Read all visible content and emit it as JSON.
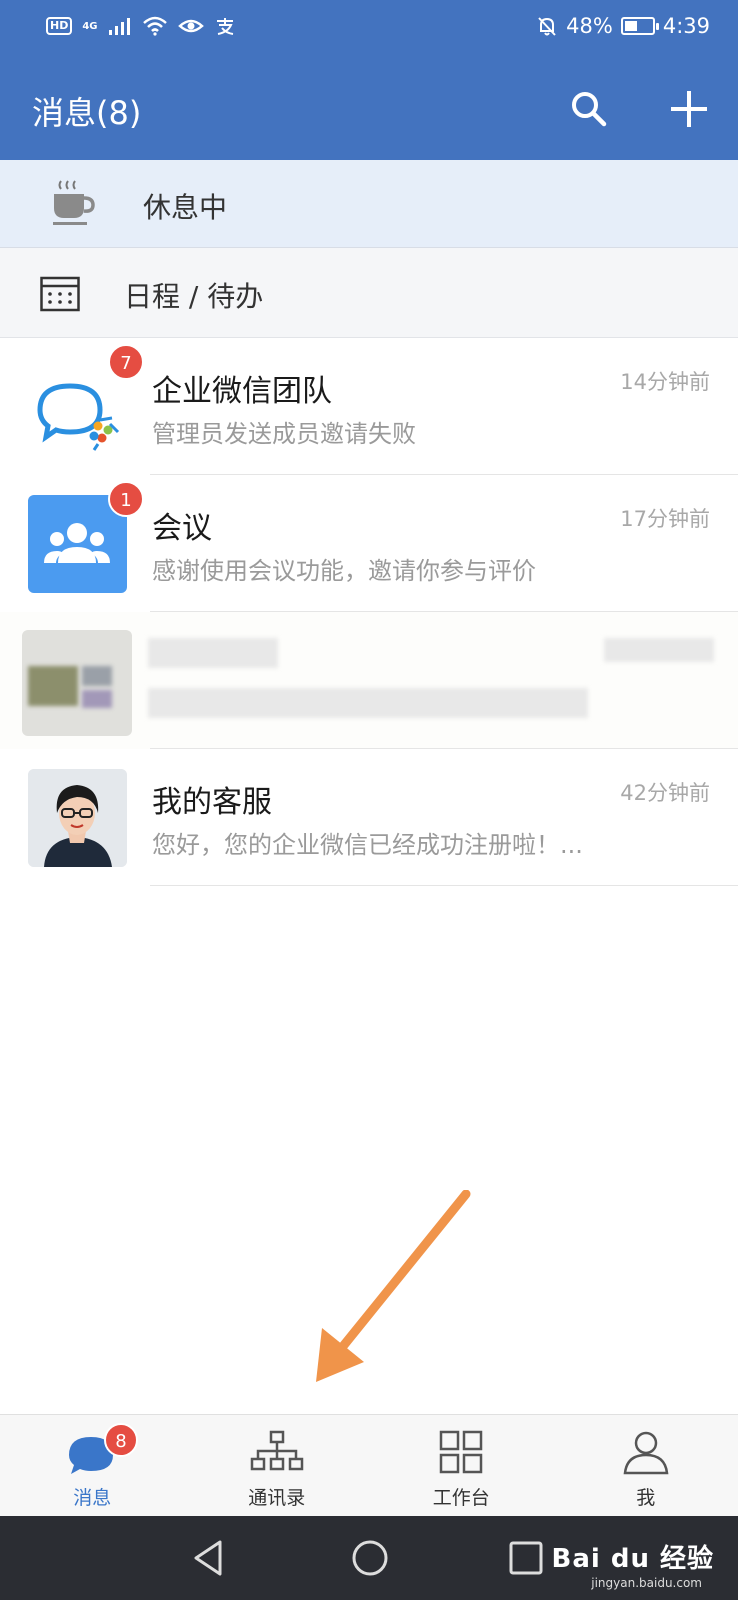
{
  "status_bar": {
    "hd": "HD",
    "network": "4G",
    "battery": "48%",
    "time": "4:39",
    "battery_level": 0.48
  },
  "header": {
    "title": "消息(8)",
    "search_icon": "search-icon",
    "add_icon": "plus-icon"
  },
  "rest_banner": {
    "icon": "coffee-cup-icon",
    "label": "休息中"
  },
  "schedule": {
    "icon": "calendar-icon",
    "label": "日程 / 待办"
  },
  "conversations": [
    {
      "name": "企业微信团队",
      "preview": "管理员发送成员邀请失败",
      "time": "14分钟前",
      "badge": "7",
      "avatar": "wecom-logo-icon"
    },
    {
      "name": "会议",
      "preview": "感谢使用会议功能，邀请你参与评价",
      "time": "17分钟前",
      "badge": "1",
      "avatar": "meeting-group-icon"
    },
    {
      "name": "",
      "preview": "",
      "time": "",
      "badge": "",
      "avatar": "blurred-avatar"
    },
    {
      "name": "我的客服",
      "preview": "您好，您的企业微信已经成功注册啦！...",
      "time": "42分钟前",
      "badge": "",
      "avatar": "customer-service-avatar"
    }
  ],
  "tabs": [
    {
      "label": "消息",
      "icon": "chat-bubble-icon",
      "badge": "8",
      "active": true
    },
    {
      "label": "通讯录",
      "icon": "org-chart-icon",
      "badge": "",
      "active": false
    },
    {
      "label": "工作台",
      "icon": "grid-icon",
      "badge": "",
      "active": false
    },
    {
      "label": "我",
      "icon": "person-icon",
      "badge": "",
      "active": false
    }
  ],
  "watermark": {
    "text": "Bai du 经验",
    "sub": "jingyan.baidu.com"
  },
  "colors": {
    "header_bg": "#4373bf",
    "badge": "#e54d42",
    "active_tab": "#3a76c9",
    "annotation_arrow": "#f0944a"
  }
}
